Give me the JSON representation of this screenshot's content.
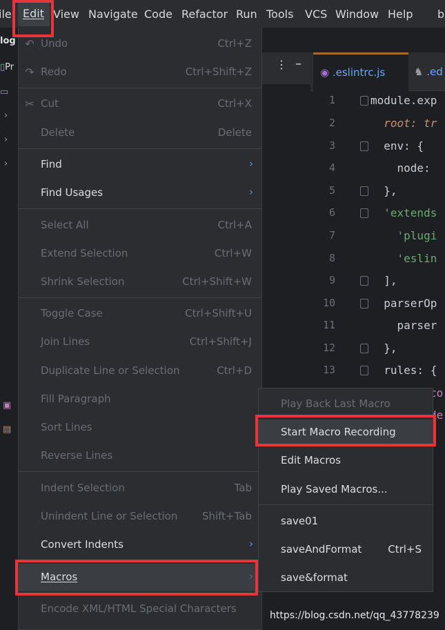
{
  "menubar": {
    "items": [
      "ile",
      "Edit",
      "View",
      "Navigate",
      "Code",
      "Refactor",
      "Run",
      "Tools",
      "VCS",
      "Window",
      "Help",
      "b"
    ]
  },
  "sidebar": {
    "project_label": "log",
    "pr_label": "Pr"
  },
  "editor": {
    "tabs": [
      ".eslintrc.js",
      ".ed"
    ],
    "lines": [
      {
        "n": "1",
        "text": "module.exp"
      },
      {
        "n": "2",
        "text": "  root: tr"
      },
      {
        "n": "3",
        "text": "  env: {"
      },
      {
        "n": "4",
        "text": "    node:"
      },
      {
        "n": "5",
        "text": "  },"
      },
      {
        "n": "6",
        "text": "  'extends"
      },
      {
        "n": "7",
        "text": "    'plugi"
      },
      {
        "n": "8",
        "text": "    'eslin"
      },
      {
        "n": "9",
        "text": "  ],"
      },
      {
        "n": "10",
        "text": "  parserOp"
      },
      {
        "n": "11",
        "text": "    parser"
      },
      {
        "n": "12",
        "text": "  },"
      },
      {
        "n": "13",
        "text": "  rules: {"
      },
      {
        "n": "",
        "text": "co"
      },
      {
        "n": "",
        "text": "de"
      }
    ]
  },
  "edit_menu": {
    "items": [
      {
        "label": "Undo",
        "shortcut": "Ctrl+Z",
        "icon": "undo-icon",
        "enabled": false
      },
      {
        "label": "Redo",
        "shortcut": "Ctrl+Shift+Z",
        "icon": "redo-icon",
        "enabled": false
      },
      {
        "label": "Cut",
        "shortcut": "Ctrl+X",
        "icon": "scissors-icon",
        "enabled": false
      },
      {
        "label": "Delete",
        "shortcut": "Delete",
        "enabled": false
      },
      {
        "label": "Find",
        "submenu": true,
        "enabled": true
      },
      {
        "label": "Find Usages",
        "submenu": true,
        "enabled": true
      },
      {
        "label": "Select All",
        "shortcut": "Ctrl+A",
        "enabled": false
      },
      {
        "label": "Extend Selection",
        "shortcut": "Ctrl+W",
        "enabled": false
      },
      {
        "label": "Shrink Selection",
        "shortcut": "Ctrl+Shift+W",
        "enabled": false
      },
      {
        "label": "Toggle Case",
        "shortcut": "Ctrl+Shift+U",
        "enabled": false
      },
      {
        "label": "Join Lines",
        "shortcut": "Ctrl+Shift+J",
        "enabled": false
      },
      {
        "label": "Duplicate Line or Selection",
        "shortcut": "Ctrl+D",
        "enabled": false
      },
      {
        "label": "Fill Paragraph",
        "enabled": false
      },
      {
        "label": "Sort Lines",
        "enabled": false
      },
      {
        "label": "Reverse Lines",
        "enabled": false
      },
      {
        "label": "Indent Selection",
        "shortcut": "Tab",
        "enabled": false
      },
      {
        "label": "Unindent Line or Selection",
        "shortcut": "Shift+Tab",
        "enabled": false
      },
      {
        "label": "Convert Indents",
        "submenu": true,
        "enabled": true
      },
      {
        "label": "Macros",
        "submenu": true,
        "enabled": true,
        "selected": true
      },
      {
        "label": "Encode XML/HTML Special Characters",
        "enabled": false
      }
    ]
  },
  "macros_submenu": {
    "items": [
      {
        "label": "Play Back Last Macro",
        "enabled": false
      },
      {
        "label": "Start Macro Recording",
        "enabled": true,
        "selected": true
      },
      {
        "label": "Edit Macros",
        "enabled": true
      },
      {
        "label": "Play Saved Macros...",
        "enabled": true
      },
      {
        "label": "save01",
        "enabled": true
      },
      {
        "label": "saveAndFormat",
        "shortcut": "Ctrl+S",
        "enabled": true
      },
      {
        "label": "save&format",
        "enabled": true
      }
    ]
  },
  "watermark": "https://blog.csdn.net/qq_43778239",
  "colors": {
    "highlight": "#e8353b",
    "menu_bg": "#2b2d30",
    "accent": "#4e9be5"
  }
}
